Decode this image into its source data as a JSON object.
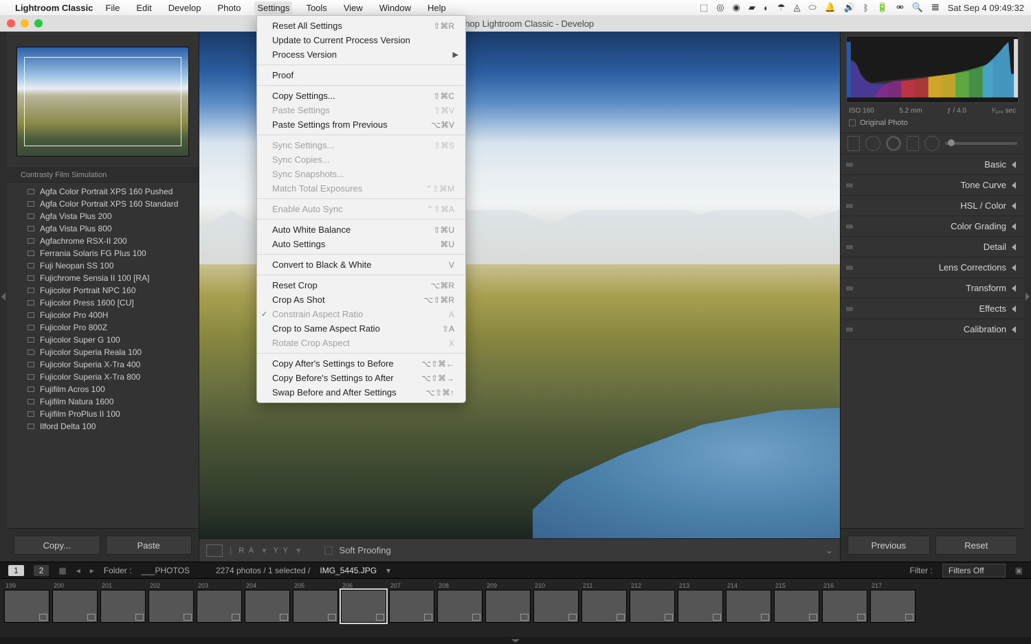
{
  "menubar": {
    "app_name": "Lightroom Classic",
    "items": [
      "File",
      "Edit",
      "Develop",
      "Photo",
      "Settings",
      "Tools",
      "View",
      "Window",
      "Help"
    ],
    "active_index": 4,
    "datetime": "Sat Sep 4  09:49:32"
  },
  "window": {
    "title": "Photoshop Lightroom Classic - Develop"
  },
  "dropdown": {
    "groups": [
      [
        {
          "label": "Reset All Settings",
          "shortcut": "⇧⌘R",
          "enabled": true
        },
        {
          "label": "Update to Current Process Version",
          "shortcut": "",
          "enabled": true
        },
        {
          "label": "Process Version",
          "shortcut": "",
          "enabled": true,
          "submenu": true
        }
      ],
      [
        {
          "label": "Proof",
          "shortcut": "",
          "enabled": true
        }
      ],
      [
        {
          "label": "Copy Settings...",
          "shortcut": "⇧⌘C",
          "enabled": true
        },
        {
          "label": "Paste Settings",
          "shortcut": "⇧⌘V",
          "enabled": false
        },
        {
          "label": "Paste Settings from Previous",
          "shortcut": "⌥⌘V",
          "enabled": true
        }
      ],
      [
        {
          "label": "Sync Settings...",
          "shortcut": "⇧⌘S",
          "enabled": false
        },
        {
          "label": "Sync Copies...",
          "shortcut": "",
          "enabled": false
        },
        {
          "label": "Sync Snapshots...",
          "shortcut": "",
          "enabled": false
        },
        {
          "label": "Match Total Exposures",
          "shortcut": "⌃⇧⌘M",
          "enabled": false
        }
      ],
      [
        {
          "label": "Enable Auto Sync",
          "shortcut": "⌃⇧⌘A",
          "enabled": false
        }
      ],
      [
        {
          "label": "Auto White Balance",
          "shortcut": "⇧⌘U",
          "enabled": true
        },
        {
          "label": "Auto Settings",
          "shortcut": "⌘U",
          "enabled": true
        }
      ],
      [
        {
          "label": "Convert to Black & White",
          "shortcut": "V",
          "enabled": true
        }
      ],
      [
        {
          "label": "Reset Crop",
          "shortcut": "⌥⌘R",
          "enabled": true
        },
        {
          "label": "Crop As Shot",
          "shortcut": "⌥⇧⌘R",
          "enabled": true
        },
        {
          "label": "Constrain Aspect Ratio",
          "shortcut": "A",
          "enabled": false,
          "checked": true
        },
        {
          "label": "Crop to Same Aspect Ratio",
          "shortcut": "⇧A",
          "enabled": true
        },
        {
          "label": "Rotate Crop Aspect",
          "shortcut": "X",
          "enabled": false
        }
      ],
      [
        {
          "label": "Copy After's Settings to Before",
          "shortcut": "⌥⇧⌘←",
          "enabled": true
        },
        {
          "label": "Copy Before's Settings to After",
          "shortcut": "⌥⇧⌘→",
          "enabled": true
        },
        {
          "label": "Swap Before and After Settings",
          "shortcut": "⌥⇧⌘↑",
          "enabled": true
        }
      ]
    ]
  },
  "presets": {
    "header": "Contrasty Film Simulation",
    "items": [
      "Agfa Color Portrait XPS 160 Pushed",
      "Agfa Color Portrait XPS 160 Standard",
      "Agfa Vista Plus 200",
      "Agfa Vista Plus 800",
      "Agfachrome RSX-II 200",
      "Ferrania Solaris FG Plus 100",
      "Fuji Neopan SS 100",
      "Fujichrome Sensia II 100 [RA]",
      "Fujicolor Portrait NPC 160",
      "Fujicolor Press 1600 [CU]",
      "Fujicolor Pro 400H",
      "Fujicolor Pro 800Z",
      "Fujicolor Super G 100",
      "Fujicolor Superia Reala 100",
      "Fujicolor Superia X-Tra 400",
      "Fujicolor Superia X-Tra 800",
      "Fujifilm Acros 100",
      "Fujifilm Natura 1600",
      "Fujifilm ProPlus II 100",
      "Ilford Delta 100"
    ]
  },
  "left_buttons": {
    "copy": "Copy...",
    "paste": "Paste"
  },
  "toolbar": {
    "soft_proofing": "Soft Proofing"
  },
  "histogram": {
    "iso": "ISO 160",
    "focal": "5.2 mm",
    "aperture": "ƒ / 4.0",
    "shutter": "¹⁄₃₂₀ sec",
    "original_label": "Original Photo"
  },
  "panels": [
    "Basic",
    "Tone Curve",
    "HSL / Color",
    "Color Grading",
    "Detail",
    "Lens Corrections",
    "Transform",
    "Effects",
    "Calibration"
  ],
  "right_buttons": {
    "previous": "Previous",
    "reset": "Reset"
  },
  "secondary": {
    "view1": "1",
    "view2": "2",
    "folder_label": "Folder :",
    "folder_name": "___PHOTOS",
    "count_text": "2274 photos / 1 selected /",
    "filename": "IMG_5445.JPG",
    "filter_label": "Filter :",
    "filter_value": "Filters Off"
  },
  "filmstrip": {
    "start_index": 199,
    "selected_index": 206,
    "styles": [
      "g-portrait",
      "g-landscape",
      "g-sky",
      "g-landscape",
      "g-brown",
      "g-mtn",
      "g-water",
      "g-mtn",
      "g-mtn",
      "g-landscape",
      "g-white",
      "g-food",
      "g-city",
      "g-bldg",
      "g-egg",
      "g-dark",
      "g-landscape",
      "g-pano",
      "g-pano"
    ]
  }
}
